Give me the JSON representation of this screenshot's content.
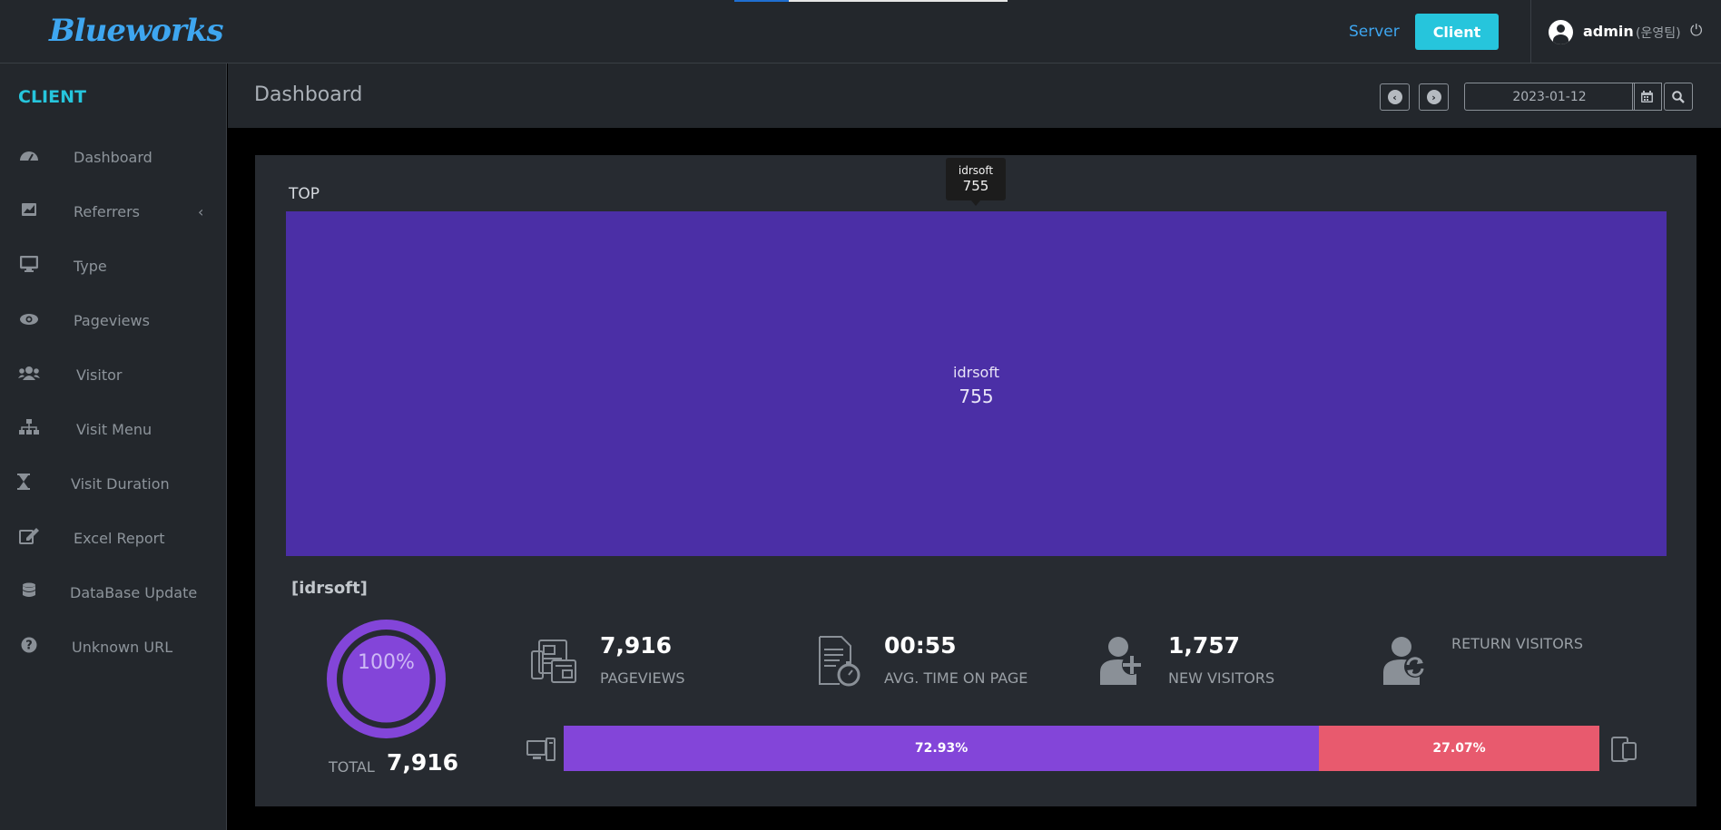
{
  "header": {
    "logo": "Blueworks",
    "nav_server": "Server",
    "nav_client": "Client",
    "user_name": "admin",
    "user_team": "(운영팀)"
  },
  "sidebar": {
    "title": "CLIENT",
    "items": [
      {
        "label": "Dashboard",
        "icon": "speedometer-icon"
      },
      {
        "label": "Referrers",
        "icon": "chart-area-icon"
      },
      {
        "label": "Type",
        "icon": "desktop-icon"
      },
      {
        "label": "Pageviews",
        "icon": "eye-icon"
      },
      {
        "label": "Visitor",
        "icon": "users-icon"
      },
      {
        "label": "Visit Menu",
        "icon": "sitemap-icon"
      },
      {
        "label": "Visit Duration",
        "icon": "hourglass-icon"
      },
      {
        "label": "Excel Report",
        "icon": "edit-icon"
      },
      {
        "label": "DataBase Update",
        "icon": "database-icon"
      },
      {
        "label": "Unknown URL",
        "icon": "question-circle-icon"
      }
    ]
  },
  "content": {
    "page_title": "Dashboard",
    "date": "2023-01-12"
  },
  "panel": {
    "top_label": "TOP",
    "site_title": "[idrsoft]",
    "donut_pct": "100%",
    "total_label": "TOTAL",
    "total_value": "7,916",
    "stats": [
      {
        "value": "7,916",
        "label": "PAGEVIEWS",
        "icon": "newspaper-icon"
      },
      {
        "value": "00:55",
        "label": "AVG. TIME ON PAGE",
        "icon": "document-stopwatch-icon"
      },
      {
        "value": "1,757",
        "label": "NEW VISITORS",
        "icon": "user-plus-icon"
      },
      {
        "value": "",
        "label": "RETURN VISITORS",
        "icon": "user-refresh-icon"
      }
    ],
    "device_split": {
      "desktop_pct": 72.93,
      "mobile_pct": 27.07,
      "desktop_label": "72.93%",
      "mobile_label": "27.07%"
    }
  },
  "chart_data": {
    "type": "treemap",
    "title": "TOP",
    "categories": [
      "idrsoft"
    ],
    "values": [
      755
    ],
    "tooltip": {
      "name": "idrsoft",
      "value": "755"
    }
  },
  "colors": {
    "accent": "#26c5dc",
    "link": "#3ea6f0",
    "treemap_fill": "#4b2fa6",
    "desktop": "#8345d9",
    "mobile": "#e85a6e"
  }
}
